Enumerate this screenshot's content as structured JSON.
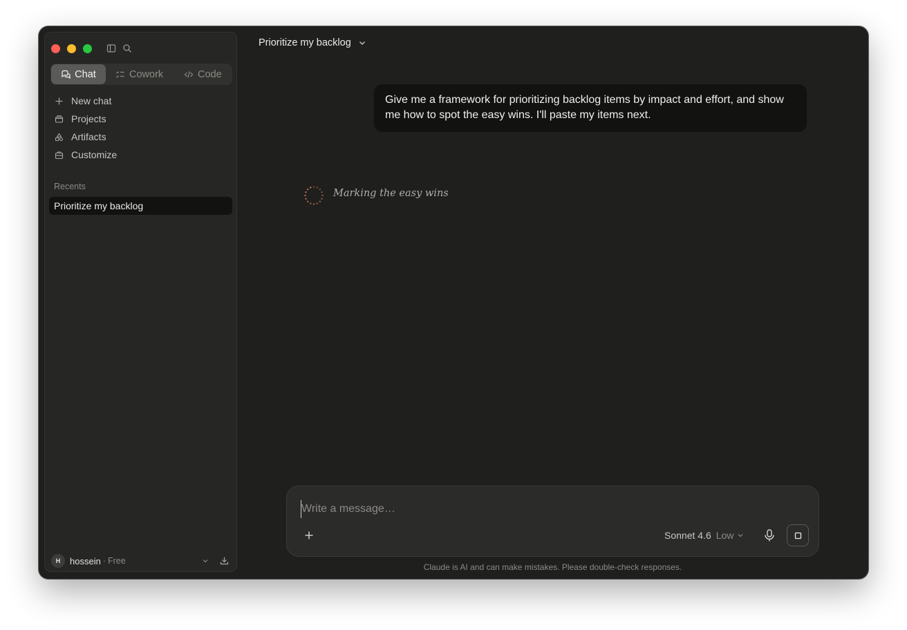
{
  "sidebar": {
    "modes": [
      {
        "label": "Chat",
        "icon": "chat-bubbles-icon",
        "active": true
      },
      {
        "label": "Cowork",
        "icon": "checklist-icon",
        "active": false
      },
      {
        "label": "Code",
        "icon": "code-brackets-icon",
        "active": false
      }
    ],
    "nav": [
      {
        "label": "New chat",
        "icon": "plus-icon"
      },
      {
        "label": "Projects",
        "icon": "folder-icon"
      },
      {
        "label": "Artifacts",
        "icon": "shapes-icon"
      },
      {
        "label": "Customize",
        "icon": "briefcase-icon"
      }
    ],
    "recents_label": "Recents",
    "recents": [
      "Prioritize my backlog"
    ],
    "user": {
      "initial": "H",
      "name": "hossein",
      "separator": "·",
      "plan": "Free"
    }
  },
  "conversation": {
    "title": "Prioritize my backlog",
    "user_message": "Give me a framework for prioritizing backlog items by impact and effort, and show me how to spot the easy wins. I'll paste my items next.",
    "status_text": "Marking the easy wins"
  },
  "composer": {
    "placeholder": "Write a message…",
    "value": "",
    "model": "Sonnet 4.6",
    "effort": "Low"
  },
  "disclaimer": "Claude is AI and can make mistakes. Please double-check responses.",
  "colors": {
    "window_bg": "#1f1f1e",
    "sidebar_bg": "#262625",
    "bubble_bg": "#121211",
    "spinner_accent": "#d97757"
  }
}
